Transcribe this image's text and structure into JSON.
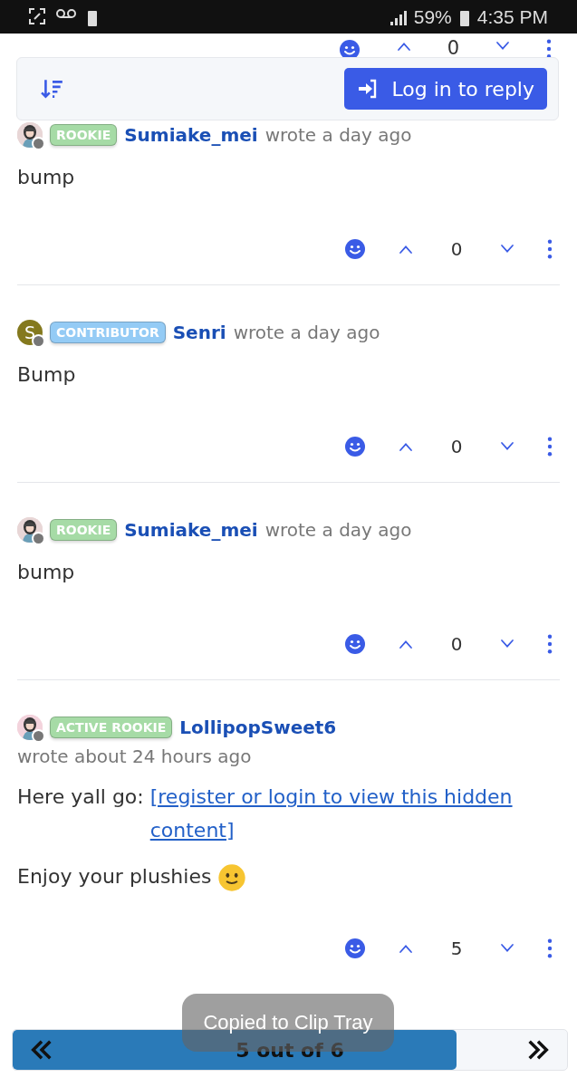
{
  "status_bar": {
    "battery": "59%",
    "time": "4:35 PM"
  },
  "hidden_row": {
    "votes": "0"
  },
  "toolbar": {
    "login_button": "Log in to reply"
  },
  "posts": [
    {
      "avatar": {
        "kind": "picture",
        "color": "#e8d6d6"
      },
      "badge": {
        "label": "ROOKIE",
        "color": "#a6dba6"
      },
      "author": "Sumiake_mei",
      "time": "wrote a day ago",
      "paragraphs": [
        {
          "text": "bump"
        }
      ],
      "votes": "0"
    },
    {
      "avatar": {
        "kind": "letter",
        "letter": "S",
        "color": "#84791e"
      },
      "badge": {
        "label": "CONTRIBUTOR",
        "color": "#94cbf5"
      },
      "author": "Senri",
      "time": "wrote a day ago",
      "paragraphs": [
        {
          "text": "Bump"
        }
      ],
      "votes": "0"
    },
    {
      "avatar": {
        "kind": "picture",
        "color": "#e8d6d6"
      },
      "badge": {
        "label": "ROOKIE",
        "color": "#a6dba6"
      },
      "author": "Sumiake_mei",
      "time": "wrote a day ago",
      "paragraphs": [
        {
          "text": "bump"
        }
      ],
      "votes": "0"
    },
    {
      "avatar": {
        "kind": "picture",
        "color": "#f3d3dc"
      },
      "badge": {
        "label": "ACTIVE ROOKIE",
        "color": "#a6dba6"
      },
      "author": "LollipopSweet6",
      "time": "wrote about 24 hours ago",
      "paragraphs": [
        {
          "text": "Here yall go: ",
          "link": "[register or login to view this hidden content]"
        },
        {
          "text": "Enjoy your plushies ",
          "emoji": true
        }
      ],
      "votes": "5"
    }
  ],
  "pager": {
    "label": "5 out of 6",
    "level": 0.8
  },
  "toast": {
    "text": "Copied to Clip Tray"
  }
}
